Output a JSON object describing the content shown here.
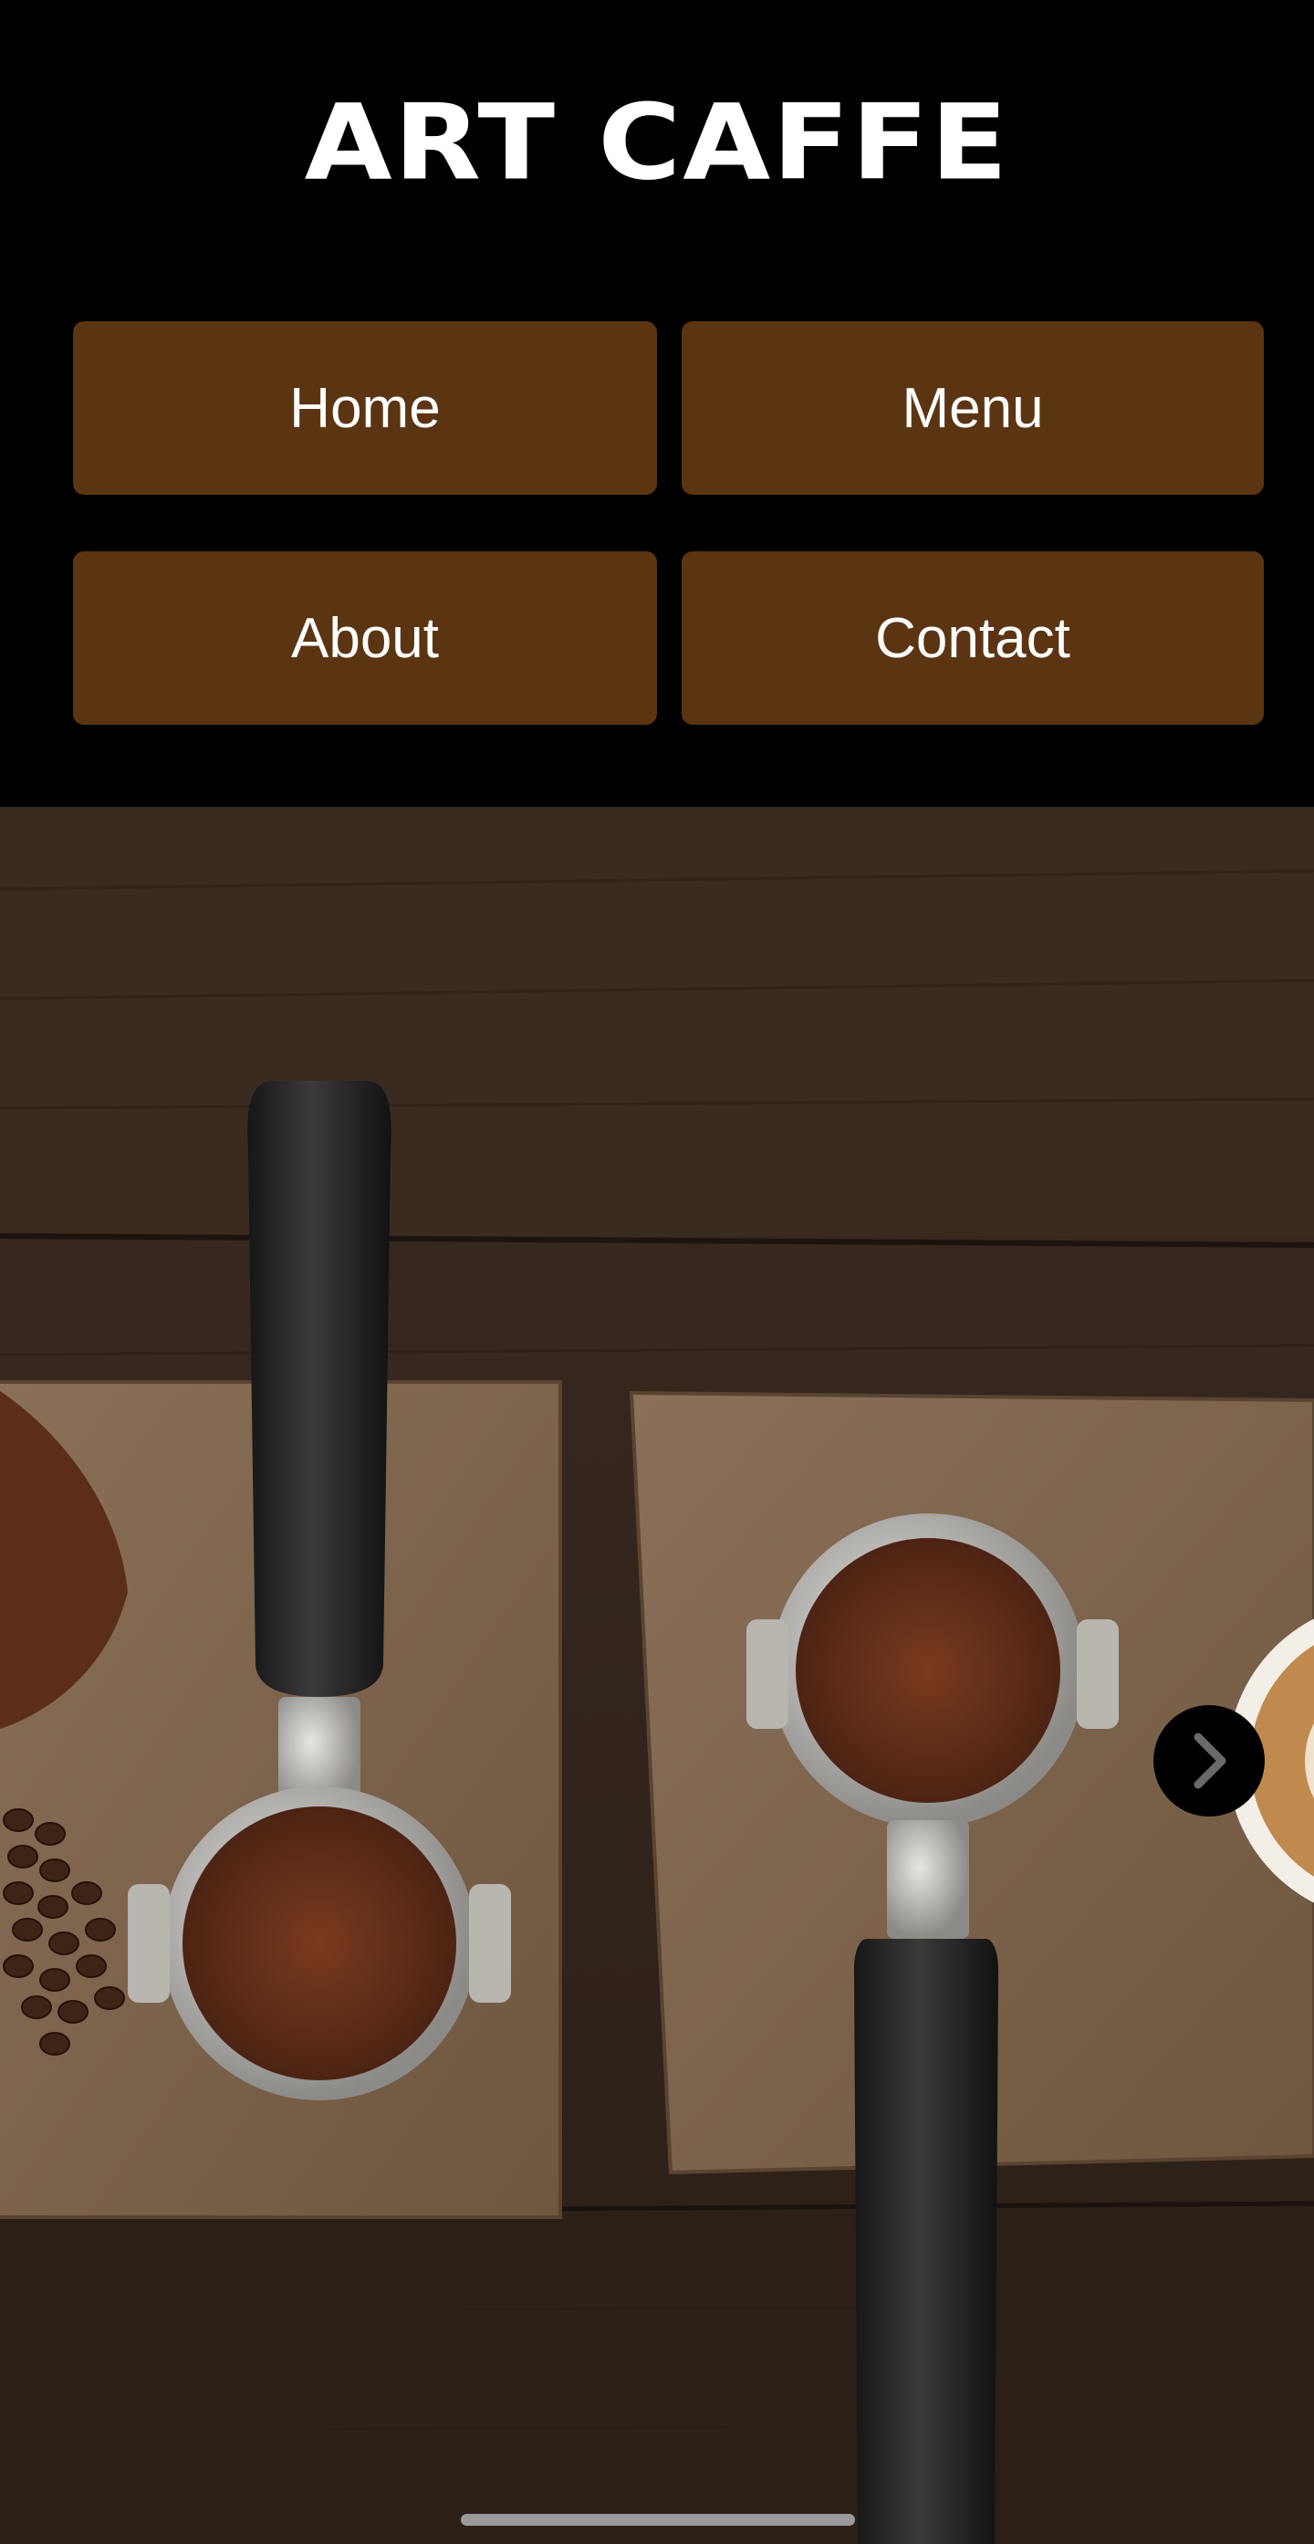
{
  "header": {
    "logo": "ART CAFFE"
  },
  "nav": {
    "home": "Home",
    "menu": "Menu",
    "about": "About",
    "contact": "Contact"
  },
  "hero": {
    "next_icon": "chevron-right-icon"
  },
  "colors": {
    "background": "#000000",
    "button": "#5b3512",
    "button_text": "#ffffff"
  }
}
